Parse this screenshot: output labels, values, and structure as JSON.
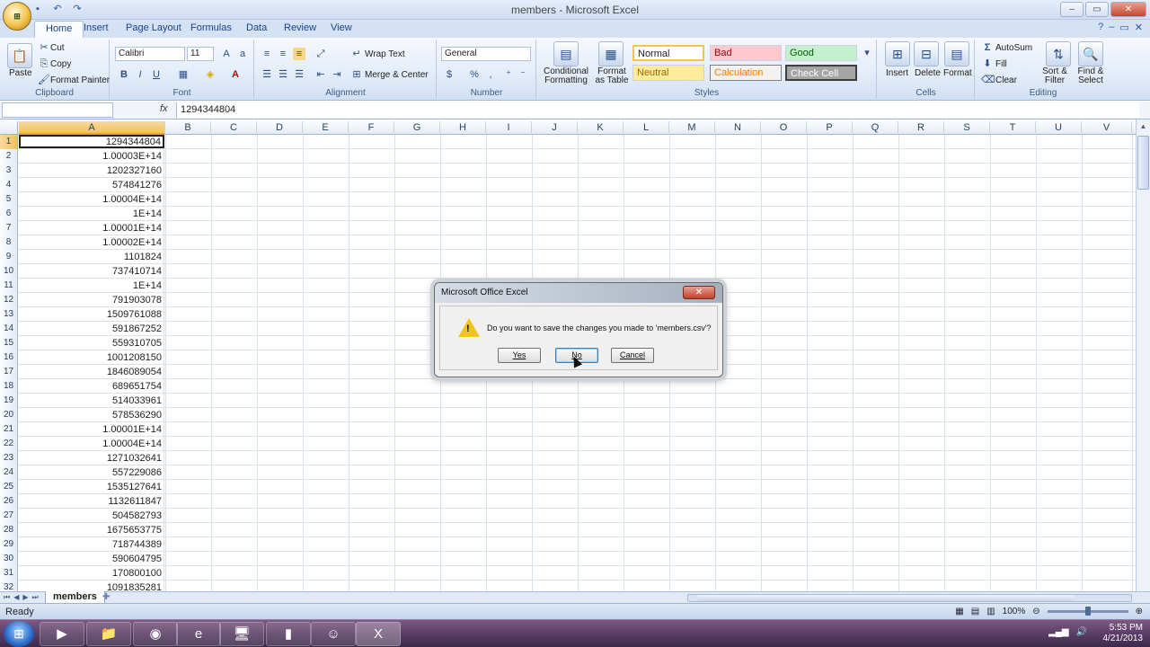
{
  "window": {
    "title": "members - Microsoft Excel",
    "office_button": "",
    "qat": [
      "save",
      "undo",
      "redo"
    ],
    "controls": [
      "–",
      "▭",
      "✕"
    ]
  },
  "ribbon": {
    "tabs": [
      "Home",
      "Insert",
      "Page Layout",
      "Formulas",
      "Data",
      "Review",
      "View"
    ],
    "active_tab": "Home",
    "clipboard": {
      "paste": "Paste",
      "cut": "Cut",
      "copy": "Copy",
      "format_painter": "Format Painter",
      "label": "Clipboard"
    },
    "font": {
      "name": "Calibri",
      "size": "11",
      "bold": "B",
      "italic": "I",
      "underline": "U",
      "label": "Font"
    },
    "alignment": {
      "wrap": "Wrap Text",
      "merge": "Merge & Center",
      "label": "Alignment"
    },
    "number": {
      "format": "General",
      "currency": "$",
      "percent": "%",
      "comma": ",",
      "label": "Number"
    },
    "styles": {
      "conditional": "Conditional Formatting",
      "format_table": "Format as Table",
      "normal": "Normal",
      "bad": "Bad",
      "good": "Good",
      "neutral": "Neutral",
      "calculation": "Calculation",
      "check_cell": "Check Cell",
      "label": "Styles"
    },
    "cells": {
      "insert": "Insert",
      "delete": "Delete",
      "format": "Format",
      "label": "Cells"
    },
    "editing": {
      "autosum": "AutoSum",
      "fill": "Fill",
      "clear": "Clear",
      "sort": "Sort & Filter",
      "find": "Find & Select",
      "label": "Editing"
    }
  },
  "formula_bar": {
    "fx": "fx",
    "value": "1294344804"
  },
  "columns": [
    "A",
    "B",
    "C",
    "D",
    "E",
    "F",
    "G",
    "H",
    "I",
    "J",
    "K",
    "L",
    "M",
    "N",
    "O",
    "P",
    "Q",
    "R",
    "S",
    "T",
    "U",
    "V"
  ],
  "rows": [
    {
      "n": "1",
      "a": "1294344804"
    },
    {
      "n": "2",
      "a": "1.00003E+14"
    },
    {
      "n": "3",
      "a": "1202327160"
    },
    {
      "n": "4",
      "a": "574841276"
    },
    {
      "n": "5",
      "a": "1.00004E+14"
    },
    {
      "n": "6",
      "a": "1E+14"
    },
    {
      "n": "7",
      "a": "1.00001E+14"
    },
    {
      "n": "8",
      "a": "1.00002E+14"
    },
    {
      "n": "9",
      "a": "1101824"
    },
    {
      "n": "10",
      "a": "737410714"
    },
    {
      "n": "11",
      "a": "1E+14"
    },
    {
      "n": "12",
      "a": "791903078"
    },
    {
      "n": "13",
      "a": "1509761088"
    },
    {
      "n": "14",
      "a": "591867252"
    },
    {
      "n": "15",
      "a": "559310705"
    },
    {
      "n": "16",
      "a": "1001208150"
    },
    {
      "n": "17",
      "a": "1846089054"
    },
    {
      "n": "18",
      "a": "689651754"
    },
    {
      "n": "19",
      "a": "514033961"
    },
    {
      "n": "20",
      "a": "578536290"
    },
    {
      "n": "21",
      "a": "1.00001E+14"
    },
    {
      "n": "22",
      "a": "1.00004E+14"
    },
    {
      "n": "23",
      "a": "1271032641"
    },
    {
      "n": "24",
      "a": "557229086"
    },
    {
      "n": "25",
      "a": "1535127641"
    },
    {
      "n": "26",
      "a": "1132611847"
    },
    {
      "n": "27",
      "a": "504582793"
    },
    {
      "n": "28",
      "a": "1675653775"
    },
    {
      "n": "29",
      "a": "718744389"
    },
    {
      "n": "30",
      "a": "590604795"
    },
    {
      "n": "31",
      "a": "170800100"
    },
    {
      "n": "32",
      "a": "1091835281"
    }
  ],
  "sheet": {
    "tab": "members"
  },
  "status": {
    "ready": "Ready",
    "zoom": "100%"
  },
  "dialog": {
    "title": "Microsoft Office Excel",
    "message": "Do you want to save the changes you made to 'members.csv'?",
    "yes": "Yes",
    "no": "No",
    "cancel": "Cancel"
  },
  "taskbar": {
    "time": "5:53 PM",
    "date": "4/21/2013"
  }
}
